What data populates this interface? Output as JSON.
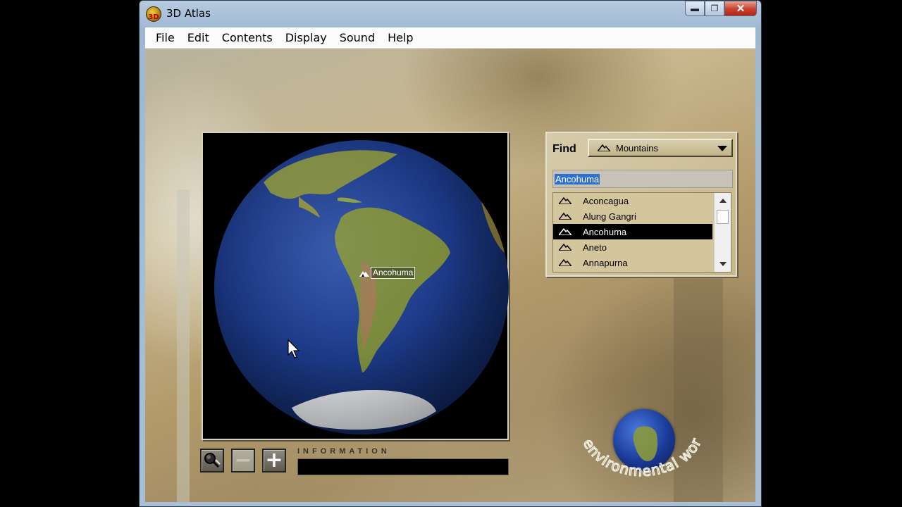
{
  "window": {
    "title": "3D Atlas",
    "app_icon_text": "3D",
    "controls": {
      "minimize": "▬",
      "maximize": "❐",
      "close": "✕"
    }
  },
  "menu": {
    "items": [
      "File",
      "Edit",
      "Contents",
      "Display",
      "Sound",
      "Help"
    ]
  },
  "globe": {
    "marker_label": "Ancohuma",
    "marker_icon": "mountain-icon"
  },
  "toolbar": {
    "zoom_tool_icon": "magnifier-pan-icon",
    "zoom_out_glyph": "−",
    "zoom_out_enabled": false,
    "zoom_in_glyph": "+",
    "information_label": "INFORMATION",
    "information_text": ""
  },
  "find": {
    "label": "Find",
    "category": "Mountains",
    "category_icon": "mountain-icon",
    "search_value": "Ancohuma",
    "results": [
      {
        "name": "Aconcagua",
        "icon": "mountain-icon",
        "selected": false
      },
      {
        "name": "Alung Gangri",
        "icon": "mountain-icon",
        "selected": false
      },
      {
        "name": "Ancohuma",
        "icon": "mountain-icon",
        "selected": true
      },
      {
        "name": "Aneto",
        "icon": "mountain-icon",
        "selected": false
      },
      {
        "name": "Annapurna",
        "icon": "mountain-icon",
        "selected": false
      }
    ]
  },
  "logo": {
    "text": "environmental world"
  },
  "colors": {
    "selection": "#000000",
    "input_highlight": "#2e6fd0",
    "ocean": "#1c3a88",
    "land": "#7a8a3a"
  }
}
